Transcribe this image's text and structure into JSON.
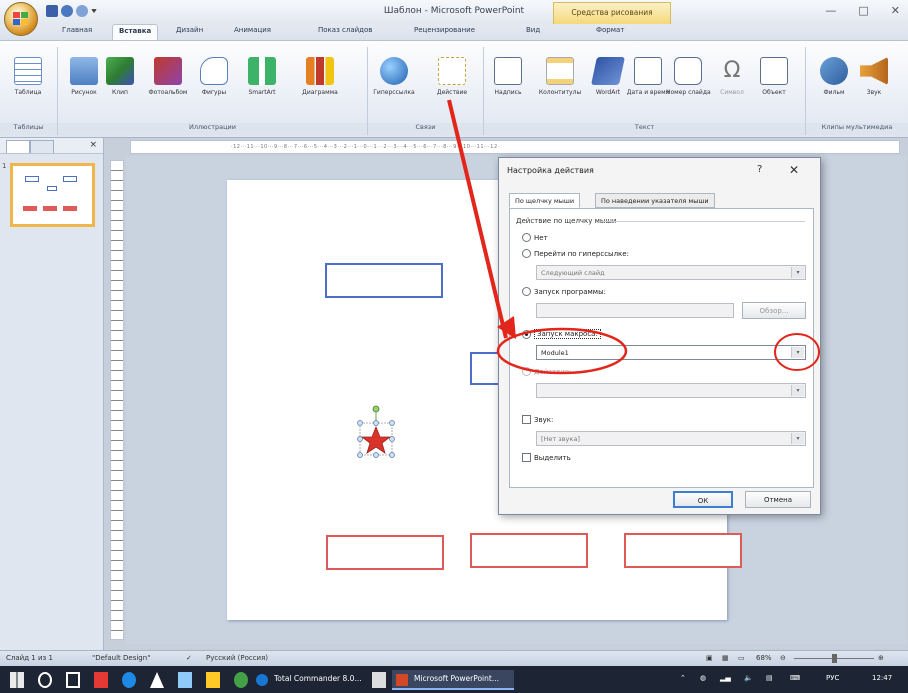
{
  "window": {
    "title": "Шаблон - Microsoft PowerPoint",
    "context_tab": "Средства рисования",
    "controls": [
      "—",
      "□",
      "✕"
    ]
  },
  "ribbon_tabs": [
    "Главная",
    "Вставка",
    "Дизайн",
    "Анимация",
    "Показ слайдов",
    "Рецензирование",
    "Вид",
    "Формат"
  ],
  "ribbon_active_tab": "Вставка",
  "ribbon": {
    "groups": [
      {
        "label": "Таблицы",
        "buttons": [
          "Таблица"
        ]
      },
      {
        "label": "Иллюстрации",
        "buttons": [
          "Рисунок",
          "Клип",
          "Фотоальбом",
          "Фигуры",
          "SmartArt",
          "Диаграмма"
        ]
      },
      {
        "label": "Связи",
        "buttons": [
          "Гиперссылка",
          "Действие"
        ]
      },
      {
        "label": "Текст",
        "buttons": [
          "Надпись",
          "Колонтитулы",
          "WordArt",
          "Дата и время",
          "Номер слайда",
          "Символ",
          "Объект"
        ]
      },
      {
        "label": "Клипы мультимедиа",
        "buttons": [
          "Фильм",
          "Звук"
        ]
      }
    ]
  },
  "slides_panel": {
    "thumb_number": "1"
  },
  "ruler_text": "·12···11···10···9···8···7···6···5···4···3···2···1···0···1···2···3···4···5···6···7···8···9···10···11···12·",
  "dialog": {
    "title": "Настройка действия",
    "help": "?",
    "close": "✕",
    "tabs": [
      "По щелчку мыши",
      "По наведении указателя мыши"
    ],
    "section": "Действие по щелчку мыши",
    "options": {
      "none": "Нет",
      "hyperlink": "Перейти по гиперссылке:",
      "hyperlink_value": "Следующий слайд",
      "program": "Запуск программы:",
      "browse": "Обзор...",
      "macro": "Запуск макроса:",
      "macro_value": "Module1",
      "object_action": "Действие:",
      "sound": "Звук:",
      "sound_value": "[Нет звука]",
      "highlight": "Выделить"
    },
    "ok": "ОК",
    "cancel": "Отмена"
  },
  "status": {
    "slide": "Слайд 1 из 1",
    "theme": "\"Default Design\"",
    "lang": "Русский (Россия)",
    "zoom": "68%"
  },
  "taskbar": {
    "total_commander": "Total Commander 8.0...",
    "powerpoint": "Microsoft PowerPoint...",
    "lang": "РУС",
    "time": "12:47"
  },
  "colors": {
    "ribbon_bg": "#e8edf5",
    "slide_blue_box": "#4a6fc4",
    "slide_red_box": "#e05a5a",
    "annotation_red": "#e2261b",
    "taskbar": "#1d2433"
  }
}
